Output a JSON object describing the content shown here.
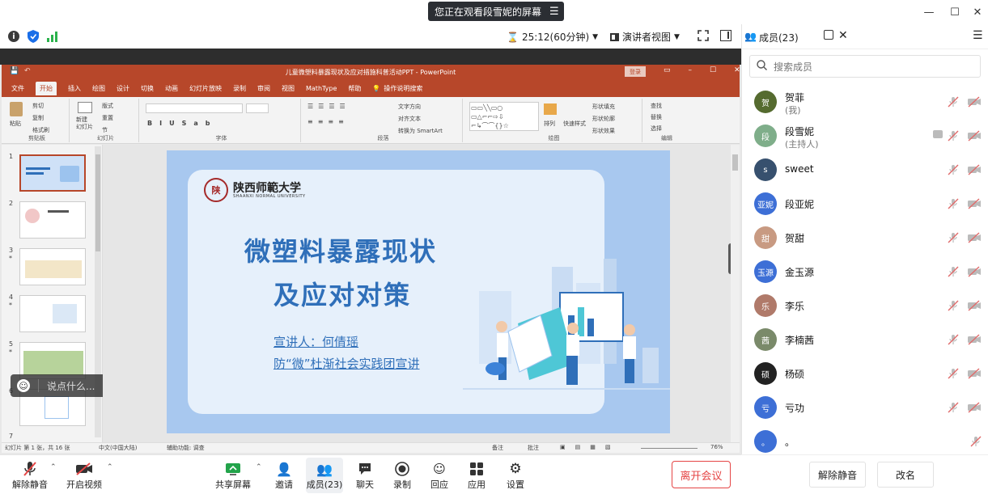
{
  "banner": {
    "text": "您正在观看段雪妮的屏幕",
    "menu_icon": "menu-lines-icon"
  },
  "window": {
    "minimize": "—",
    "maximize": "☐",
    "close": "✕"
  },
  "toolbar": {
    "timer": "25:12(60分钟)",
    "view_mode": "演讲者视图",
    "members_tab": "成员(23)"
  },
  "ppt": {
    "title": "儿童微塑料暴露现状及应对措施科普活动PPT - PowerPoint",
    "login": "登录",
    "tabs": [
      "文件",
      "开始",
      "插入",
      "绘图",
      "设计",
      "切换",
      "动画",
      "幻灯片放映",
      "录制",
      "审阅",
      "视图",
      "MathType",
      "帮助",
      "操作说明搜索"
    ],
    "active_tab": "开始",
    "groups": [
      "剪贴板",
      "幻灯片",
      "字体",
      "段落",
      "绘图",
      "编辑"
    ],
    "ribbon": {
      "paste": "粘贴",
      "cut": "剪切",
      "copy": "复制",
      "format_painter": "格式刷",
      "new_slide": "新建\n幻灯片",
      "layout": "版式",
      "reset": "重置",
      "section": "节",
      "text_direction": "文字方向",
      "align_text": "对齐文本",
      "smartart": "转换为 SmartArt",
      "arrange": "排列",
      "quick_styles": "快速样式",
      "shape_fill": "形状填充",
      "shape_outline": "形状轮廓",
      "shape_effects": "形状效果",
      "find": "查找",
      "replace": "替换",
      "select": "选择"
    },
    "thumb_numbers": [
      "1",
      "2",
      "3",
      "4",
      "5",
      "6",
      "7"
    ],
    "thumb_marks": [
      "",
      "",
      "*",
      "*",
      "*",
      "",
      ""
    ],
    "status": {
      "slide_info": "幻灯片 第 1 张，共 16 张",
      "language": "中文(中国大陆)",
      "accessibility": "辅助功能: 调查",
      "notes": "备注",
      "comments": "批注",
      "zoom": "76%"
    }
  },
  "slide": {
    "university_cn": "陕西师範大学",
    "university_en": "SHAANXI NORMAL UNIVERSITY",
    "title_line1": "微塑料暴露现状",
    "title_line2": "及应对对策",
    "speaker": "宣讲人：何倩瑶",
    "team": "防“微”杜渐社会实践团宣讲",
    "colors": {
      "background": "#a8c8ef",
      "card": "#e6f0fb",
      "title": "#2f6fb9",
      "link": "#2f6fb9"
    }
  },
  "chat_bubble": {
    "placeholder": "说点什么..."
  },
  "controls": {
    "unmute": "解除静音",
    "start_video": "开启视频",
    "share_screen": "共享屏幕",
    "invite": "邀请",
    "members": "成员(23)",
    "chat": "聊天",
    "record": "录制",
    "reactions": "回应",
    "apps": "应用",
    "settings": "设置",
    "leave": "离开会议"
  },
  "panel": {
    "search_placeholder": "搜索成员",
    "members": [
      {
        "name": "贺菲",
        "role": "(我)",
        "avatar": "贺",
        "color": "#556b2f"
      },
      {
        "name": "段雪妮",
        "role": "(主持人)",
        "avatar": "段",
        "color": "#7fae8a"
      },
      {
        "name": "sweet",
        "role": "",
        "avatar": "s",
        "color": "#37506e"
      },
      {
        "name": "段亚妮",
        "role": "",
        "avatar": "亚妮",
        "color": "#3d6fd6"
      },
      {
        "name": "贺甜",
        "role": "",
        "avatar": "甜",
        "color": "#c89a82"
      },
      {
        "name": "金玉源",
        "role": "",
        "avatar": "玉源",
        "color": "#3d6fd6"
      },
      {
        "name": "李乐",
        "role": "",
        "avatar": "乐",
        "color": "#b07a6a"
      },
      {
        "name": "李楠茜",
        "role": "",
        "avatar": "茜",
        "color": "#7a8a6a"
      },
      {
        "name": "杨硕",
        "role": "",
        "avatar": "硕",
        "color": "#222222"
      },
      {
        "name": "亏功",
        "role": "",
        "avatar": "亏",
        "color": "#3d6fd6"
      },
      {
        "name": "。",
        "role": "",
        "avatar": "。",
        "color": "#3d6fd6"
      }
    ],
    "unmute_all": "解除静音",
    "rename": "改名"
  }
}
